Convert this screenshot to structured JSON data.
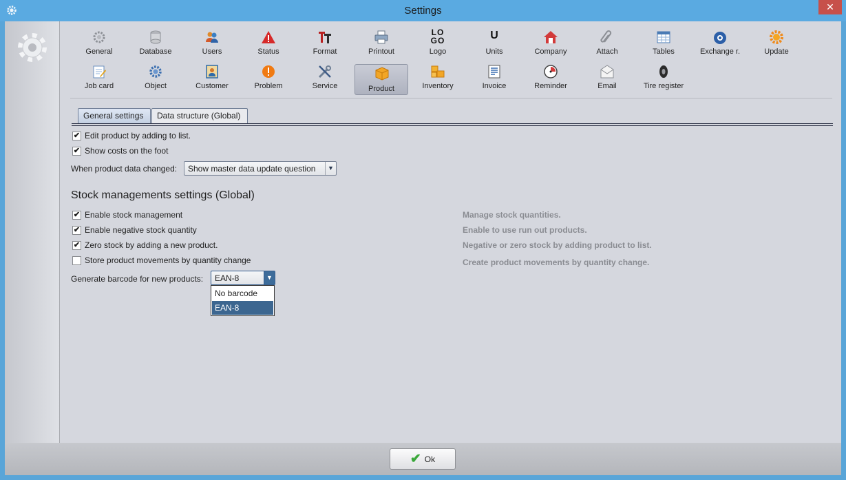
{
  "window": {
    "title": "Settings",
    "close_glyph": "✕"
  },
  "toolbar": {
    "row1": [
      {
        "label": "General",
        "icon": "gear-icon"
      },
      {
        "label": "Database",
        "icon": "database-icon"
      },
      {
        "label": "Users",
        "icon": "users-icon"
      },
      {
        "label": "Status",
        "icon": "warning-icon"
      },
      {
        "label": "Format",
        "icon": "format-icon"
      },
      {
        "label": "Printout",
        "icon": "printer-icon"
      },
      {
        "label": "Logo",
        "icon": "logo-icon"
      },
      {
        "label": "Units",
        "icon": "units-icon"
      },
      {
        "label": "Company",
        "icon": "house-icon"
      },
      {
        "label": "Attach",
        "icon": "paperclip-icon"
      },
      {
        "label": "Tables",
        "icon": "table-icon"
      },
      {
        "label": "Exchange r.",
        "icon": "exchange-icon"
      },
      {
        "label": "Update",
        "icon": "update-icon"
      }
    ],
    "row2": [
      {
        "label": "Job card",
        "icon": "jobcard-icon"
      },
      {
        "label": "Object",
        "icon": "object-icon"
      },
      {
        "label": "Customer",
        "icon": "customer-icon"
      },
      {
        "label": "Problem",
        "icon": "problem-icon"
      },
      {
        "label": "Service",
        "icon": "tools-icon"
      },
      {
        "label": "Product",
        "icon": "box-icon"
      },
      {
        "label": "Inventory",
        "icon": "boxes-icon"
      },
      {
        "label": "Invoice",
        "icon": "invoice-icon"
      },
      {
        "label": "Reminder",
        "icon": "clock-icon"
      },
      {
        "label": "Email",
        "icon": "envelope-icon"
      },
      {
        "label": "Tire register",
        "icon": "tire-icon"
      }
    ],
    "logo_text_top": "LO",
    "logo_text_bottom": "GO",
    "units_glyph": "U"
  },
  "tabs": [
    "General settings",
    "Data structure (Global)"
  ],
  "general": {
    "edit_product_label": "Edit product by adding to list.",
    "show_costs_label": "Show costs on the foot",
    "product_changed_label": "When product data changed:",
    "product_changed_value": "Show master data update question"
  },
  "stock": {
    "title": "Stock managements settings (Global)",
    "items": [
      {
        "label": "Enable stock management",
        "checked": true,
        "hint": "Manage stock quantities."
      },
      {
        "label": "Enable negative stock quantity",
        "checked": true,
        "hint": "Enable to use run out products."
      },
      {
        "label": "Zero stock by adding a new product.",
        "checked": true,
        "hint": "Negative or zero stock by adding product to list."
      },
      {
        "label": "Store product movements by quantity change",
        "checked": false,
        "hint": "Create product movements by quantity change."
      }
    ],
    "barcode_label": "Generate barcode for new products:",
    "barcode_value": "EAN-8",
    "barcode_options": [
      "No barcode",
      "EAN-8"
    ]
  },
  "footer": {
    "ok_label": "Ok",
    "ok_glyph": "✔"
  },
  "colors": {
    "titlebar": "#5aaae1",
    "client": "#d5d7de",
    "close": "#c7504a",
    "selection": "#3c6690"
  }
}
